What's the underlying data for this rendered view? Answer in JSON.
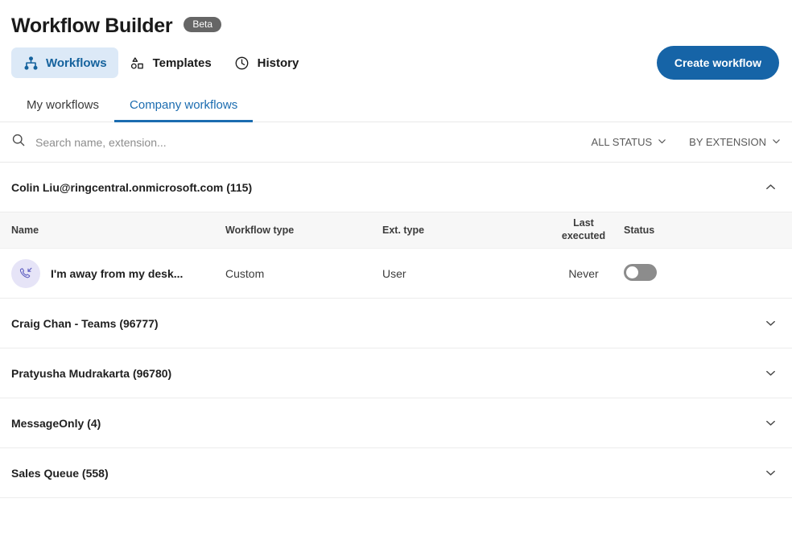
{
  "header": {
    "title": "Workflow Builder",
    "badge": "Beta"
  },
  "nav": {
    "items": [
      {
        "label": "Workflows",
        "icon": "hierarchy-icon",
        "active": true
      },
      {
        "label": "Templates",
        "icon": "shapes-icon",
        "active": false
      },
      {
        "label": "History",
        "icon": "clock-icon",
        "active": false
      }
    ],
    "create_button": "Create workflow"
  },
  "subtabs": [
    {
      "label": "My workflows",
      "active": false
    },
    {
      "label": "Company workflows",
      "active": true
    }
  ],
  "search": {
    "placeholder": "Search name, extension...",
    "value": "",
    "icon": "search-icon"
  },
  "filters": [
    {
      "label": "ALL STATUS",
      "icon": "chevron-down-icon"
    },
    {
      "label": "BY EXTENSION",
      "icon": "chevron-down-icon"
    }
  ],
  "table": {
    "columns": [
      "Name",
      "Workflow type",
      "Ext. type",
      "Last\nexecuted",
      "Status"
    ],
    "column_last_line1": "Last",
    "column_last_line2": "executed"
  },
  "groups": [
    {
      "title": "Colin Liu@ringcentral.onmicrosoft.com (115)",
      "expanded": true,
      "chevron": "chevron-up-icon",
      "rows": [
        {
          "name": "I'm away from my desk...",
          "avatar_icon": "incoming-call-icon",
          "workflow_type": "Custom",
          "ext_type": "User",
          "last_executed": "Never",
          "status_enabled": false
        }
      ]
    },
    {
      "title": "Craig Chan - Teams (96777)",
      "expanded": false,
      "chevron": "chevron-down-icon",
      "rows": []
    },
    {
      "title": "Pratyusha Mudrakarta (96780)",
      "expanded": false,
      "chevron": "chevron-down-icon",
      "rows": []
    },
    {
      "title": "MessageOnly (4)",
      "expanded": false,
      "chevron": "chevron-down-icon",
      "rows": []
    },
    {
      "title": "Sales Queue (558)",
      "expanded": false,
      "chevron": "chevron-down-icon",
      "rows": []
    }
  ],
  "colors": {
    "accent_blue": "#1664a7",
    "active_tab_bg": "#dce9f7",
    "active_tab_text": "#15629d",
    "badge_gray": "#666666",
    "avatar_bg": "#e6e4f7",
    "avatar_icon": "#5b5bbf",
    "toggle_off": "#8c8c8c",
    "table_head_bg": "#f7f7f7"
  }
}
